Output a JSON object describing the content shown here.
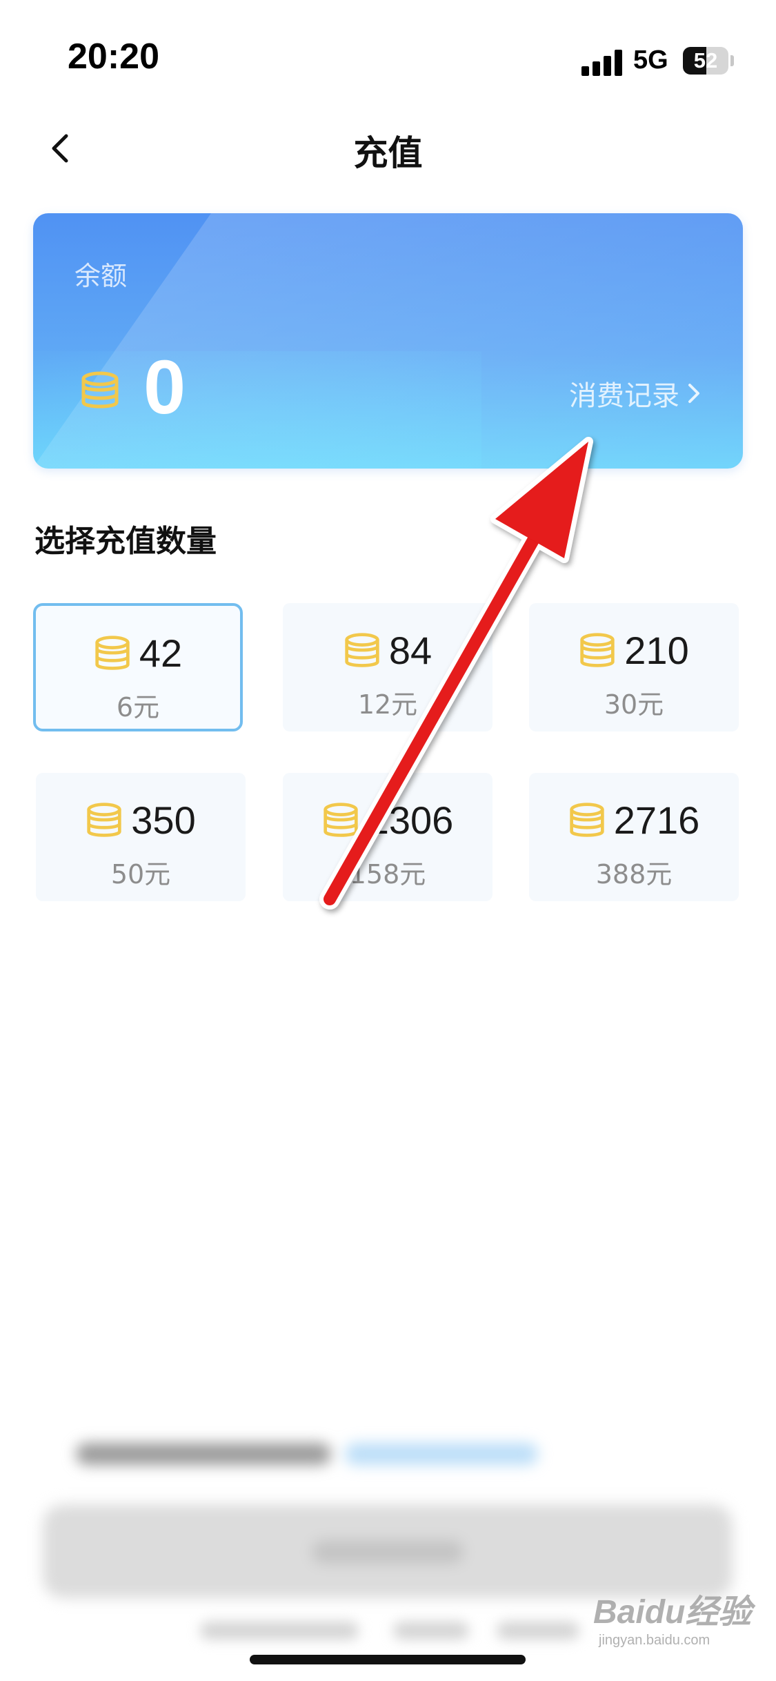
{
  "status_bar": {
    "time": "20:20",
    "network": "5G",
    "battery": "52",
    "battery_level": 0.52
  },
  "nav": {
    "title": "充值",
    "back_icon": "chevron-left-icon"
  },
  "balance_card": {
    "label": "余额",
    "value": "0",
    "coin_icon": "coin-stack-icon",
    "records_link": "消费记录",
    "gradient_colors": [
      "#5092f3",
      "#6cd3fb"
    ]
  },
  "section_title": "选择充值数量",
  "packages": [
    {
      "amount": "42",
      "price": "6元",
      "selected": true
    },
    {
      "amount": "84",
      "price": "12元",
      "selected": false
    },
    {
      "amount": "210",
      "price": "30元",
      "selected": false
    },
    {
      "amount": "350",
      "price": "50元",
      "selected": false
    },
    {
      "amount": "1306",
      "price": "158元",
      "selected": false
    },
    {
      "amount": "2716",
      "price": "388元",
      "selected": false
    }
  ],
  "watermark": {
    "main": "Baidu经验",
    "sub": "jingyan.baidu.com"
  },
  "colors": {
    "selected_border": "#72bdef",
    "coin": "#f2c84b",
    "annotation_arrow": "#e51a1a"
  }
}
